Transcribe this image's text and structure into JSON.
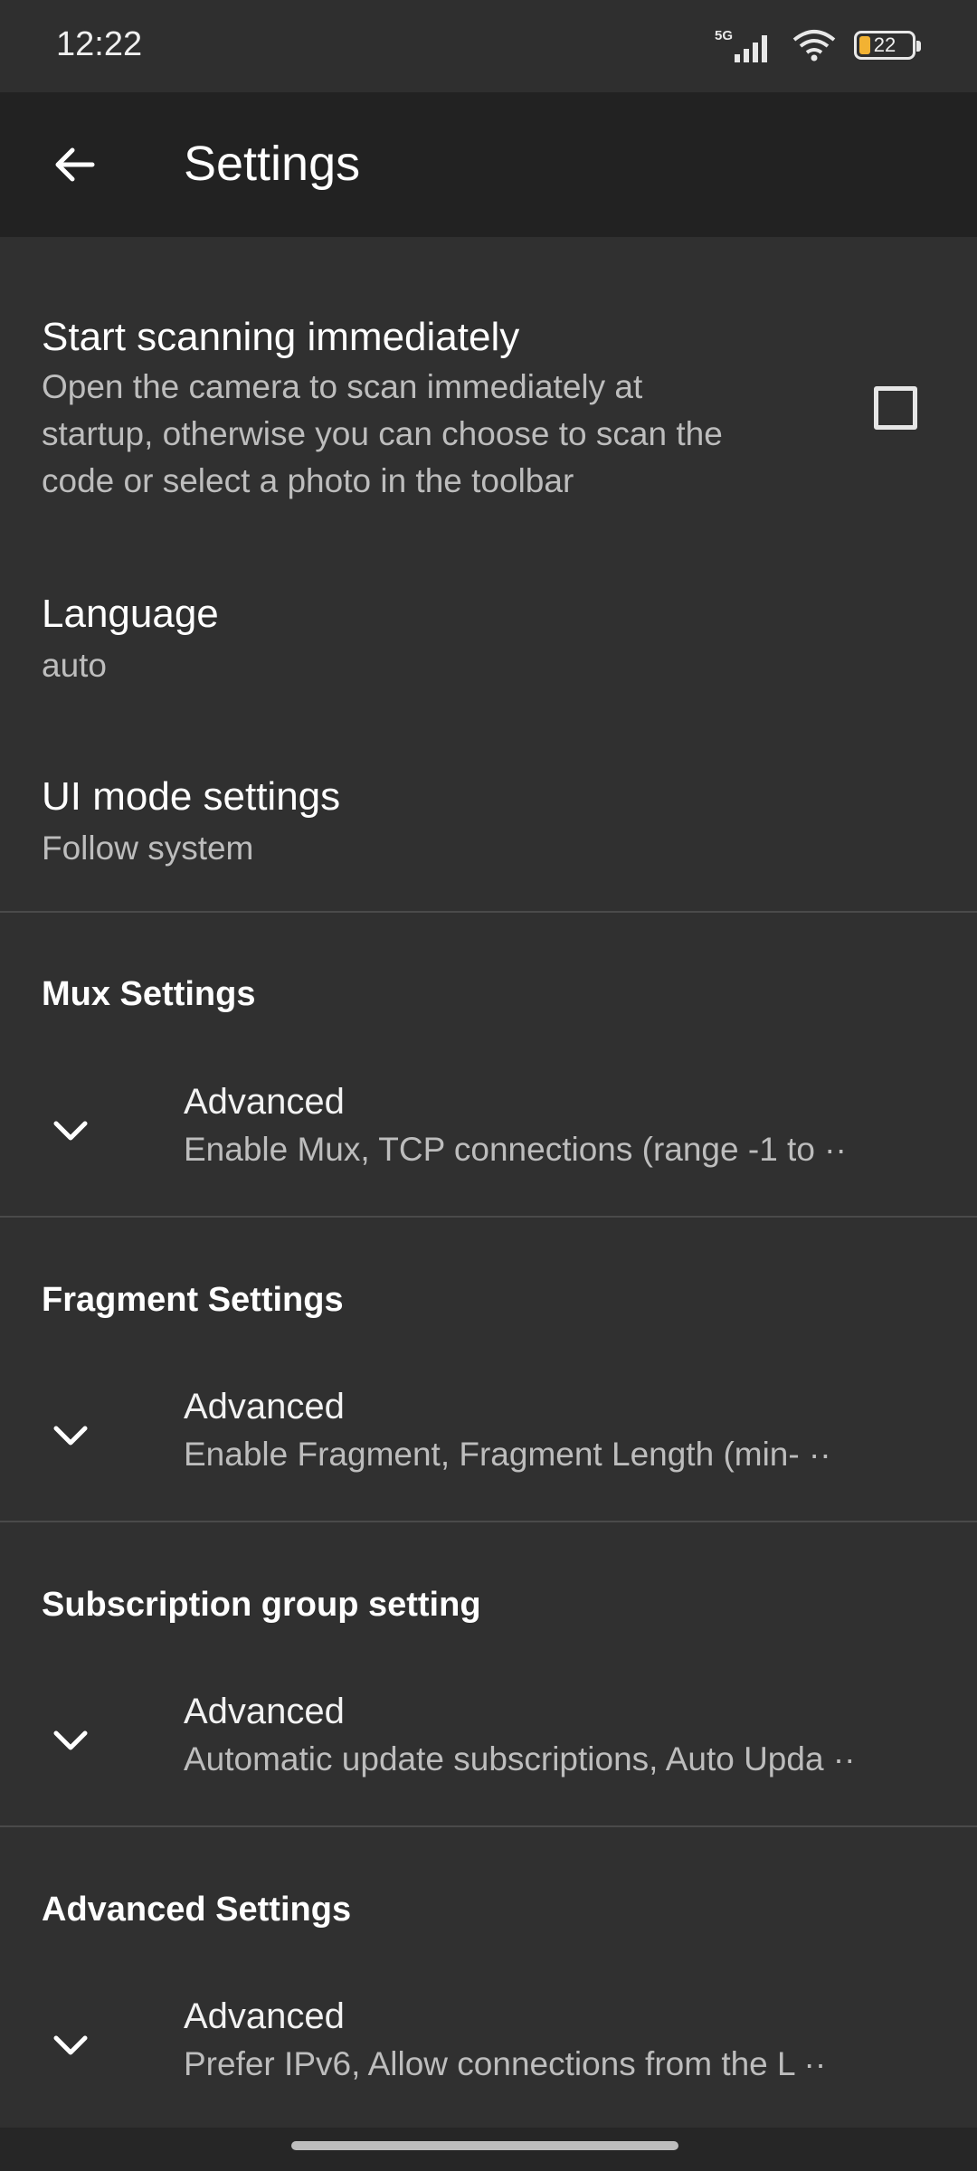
{
  "status_bar": {
    "time": "12:22",
    "network_label": "5G",
    "battery_level": "22",
    "icons": [
      "signal-icon",
      "wifi-icon",
      "battery-icon"
    ]
  },
  "app_bar": {
    "title": "Settings",
    "back_icon": "arrow-left-icon"
  },
  "general": {
    "start_scanning": {
      "title": "Start scanning immediately",
      "subtitle_lines": [
        "Open the camera to scan immediately at",
        "startup, otherwise you can choose to scan the",
        "code or select a photo in the toolbar"
      ],
      "checked": false
    },
    "language": {
      "title": "Language",
      "value": "auto"
    },
    "ui_mode": {
      "title": "UI mode settings",
      "value": "Follow system"
    }
  },
  "sections": [
    {
      "header": "Mux Settings",
      "row": {
        "title": "Advanced",
        "summary": "Enable Mux, TCP connections (range -1 to ··"
      }
    },
    {
      "header": "Fragment Settings",
      "row": {
        "title": "Advanced",
        "summary": "Enable Fragment, Fragment Length (min- ··"
      }
    },
    {
      "header": "Subscription group setting",
      "row": {
        "title": "Advanced",
        "summary": "Automatic update subscriptions, Auto Upda ··"
      }
    },
    {
      "header": "Advanced Settings",
      "row": {
        "title": "Advanced",
        "summary": "Prefer IPv6, Allow connections from the L ··"
      }
    }
  ],
  "colors": {
    "background": "#303030",
    "app_bar": "#222222",
    "secondary_text": "#bdbdbd",
    "battery_accent": "#f2b233"
  }
}
